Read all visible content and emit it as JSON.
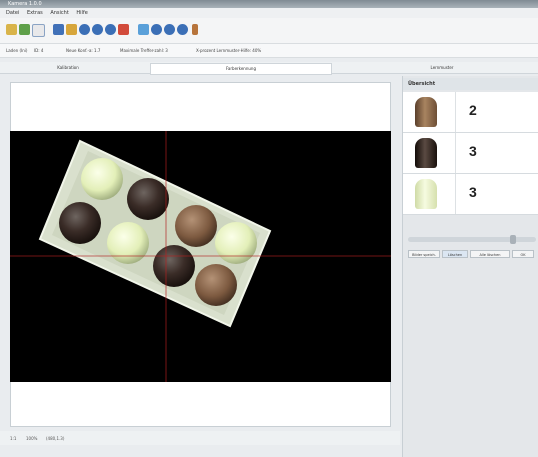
{
  "window": {
    "title": "Kamera 1.0.0"
  },
  "menu": [
    "Datei",
    "Extras",
    "Ansicht",
    "Hilfe"
  ],
  "params": {
    "p1": "Laden (Ini)",
    "p2": "ID: 4",
    "p3": "Neue Konf.-a: 1.7",
    "p4": "Maximale Treffer-zahl: 3",
    "p5": "X-prozent Lernmuster-Hilfe: 40%"
  },
  "tabs": [
    "Kalibration",
    "Farberkennung",
    "Lernmuster"
  ],
  "right_panel": {
    "header": "Übersicht",
    "rows": [
      {
        "icon": "milk-chocolate-praline-icon",
        "count": "2",
        "color": "#8e6a4b"
      },
      {
        "icon": "dark-chocolate-praline-icon",
        "count": "3",
        "color": "#2e211b"
      },
      {
        "icon": "white-chocolate-praline-icon",
        "count": "3",
        "color": "#e9f1c4"
      }
    ],
    "buttons": [
      "Bilder speich.",
      "Löschen",
      "Alle löschen",
      "OK"
    ]
  },
  "status": {
    "left": "1:1",
    "zoom": "100%",
    "coords": "(480,1.3)"
  },
  "colors": {
    "accent": "#3b6fb6",
    "crosshair": "#b32020"
  }
}
